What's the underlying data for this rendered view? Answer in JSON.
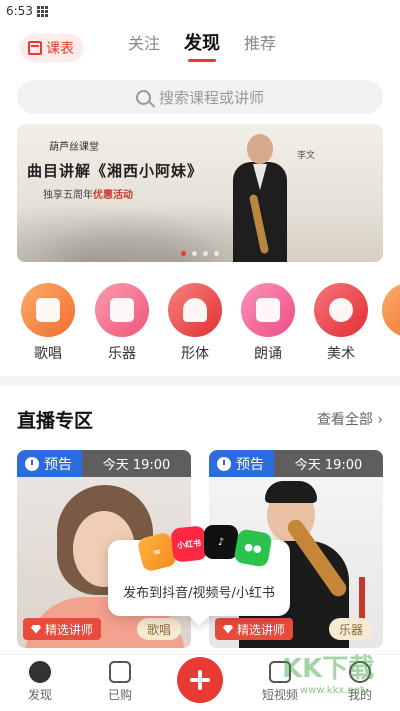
{
  "status_bar": {
    "time": "6:53"
  },
  "header": {
    "schedule_label": "课表",
    "tabs": [
      {
        "label": "关注",
        "active": false
      },
      {
        "label": "发现",
        "active": true
      },
      {
        "label": "推荐",
        "active": false
      }
    ]
  },
  "search": {
    "placeholder": "搜索课程或讲师"
  },
  "banner": {
    "brand": "葫芦丝课堂",
    "title": "曲目讲解《湘西小阿妹》",
    "promo_prefix": "独享五周年",
    "promo_highlight": "优惠活动",
    "stamp": "李文",
    "slides_total": 4,
    "active_slide": 1
  },
  "categories": [
    {
      "label": "歌唱",
      "color": "#f5863a",
      "icon": "singing-icon"
    },
    {
      "label": "乐器",
      "color": "#f3698a",
      "icon": "instrument-icon"
    },
    {
      "label": "形体",
      "color": "#ec4a48",
      "icon": "dance-icon"
    },
    {
      "label": "朗诵",
      "color": "#f26091",
      "icon": "recitation-icon"
    },
    {
      "label": "美术",
      "color": "#ee3f45",
      "icon": "art-icon"
    }
  ],
  "live": {
    "title": "直播专区",
    "more": "查看全部 ›",
    "cards": [
      {
        "status": "预告",
        "time": "今天 19:00",
        "badge": "精选讲师",
        "tag": "歌唱"
      },
      {
        "status": "预告",
        "time": "今天 19:00",
        "badge": "精选讲师",
        "tag": "乐器"
      }
    ]
  },
  "share_popup": {
    "text": "发布到抖音/视频号/小红书",
    "apps": [
      "视频号",
      "小红书",
      "抖音",
      "微信"
    ]
  },
  "bottom_nav": [
    {
      "label": "发现",
      "icon": "compass-icon"
    },
    {
      "label": "已购",
      "icon": "purchased-icon"
    },
    {
      "label": "",
      "icon": "plus-icon"
    },
    {
      "label": "短视频",
      "icon": "video-icon"
    },
    {
      "label": "我的",
      "icon": "profile-icon"
    }
  ],
  "watermark": {
    "text": "KK下载",
    "sub": "www.kkx.net"
  },
  "colors": {
    "accent": "#e63a33",
    "live_blue": "#2d6be0"
  }
}
